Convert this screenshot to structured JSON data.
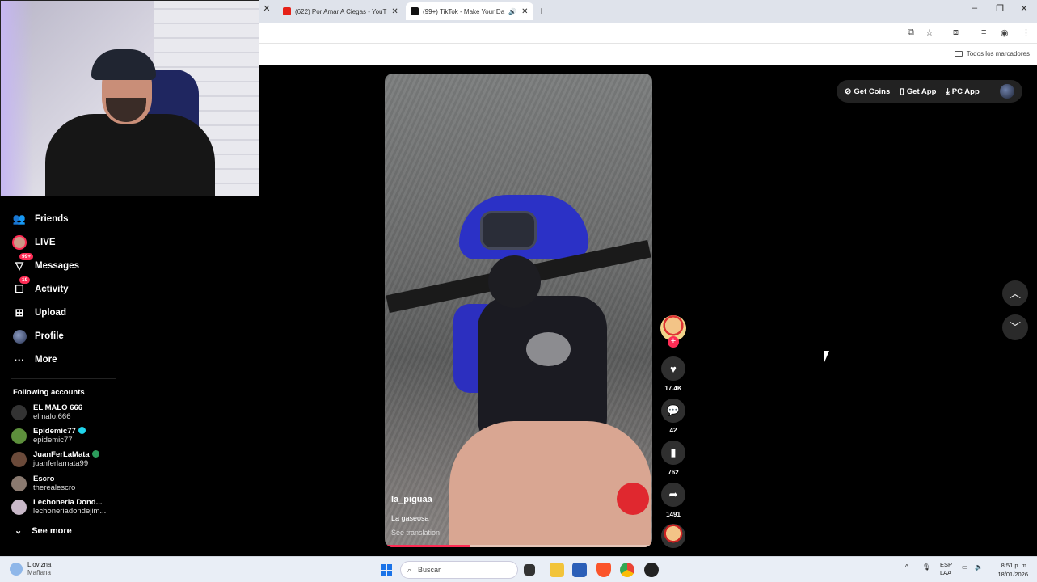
{
  "browser": {
    "tabs": [
      {
        "title": "(622) Por Amar A Ciegas - YouT",
        "active": false,
        "favicon_color": "#e62117"
      },
      {
        "title": "(99+) TikTok - Make Your Da",
        "active": true,
        "favicon_color": "#111111"
      }
    ],
    "new_tab_symbol": "+",
    "window_controls": [
      "–",
      "❐",
      "✕"
    ],
    "bookmarks_folder_label": "Todos los marcadores"
  },
  "sidebar": {
    "items": [
      {
        "label": "Friends",
        "icon": "friends-icon",
        "badge": ""
      },
      {
        "label": "LIVE",
        "icon": "live-icon",
        "badge": ""
      },
      {
        "label": "Messages",
        "icon": "messages-icon",
        "badge": "99+"
      },
      {
        "label": "Activity",
        "icon": "activity-icon",
        "badge": "19"
      },
      {
        "label": "Upload",
        "icon": "upload-icon",
        "badge": ""
      },
      {
        "label": "Profile",
        "icon": "profile-icon",
        "badge": ""
      },
      {
        "label": "More",
        "icon": "more-icon",
        "badge": ""
      }
    ],
    "following_title": "Following accounts",
    "accounts": [
      {
        "name": "EL MALO 666",
        "username": "elmalo.666",
        "verified": false,
        "color": "#333333"
      },
      {
        "name": "Epidemic77",
        "username": "epidemic77",
        "verified": true,
        "color": "#5d8f3c"
      },
      {
        "name": "JuanFerLaMata",
        "username": "juanferlamata99",
        "verified": true,
        "color": "#6b4a3a"
      },
      {
        "name": "Escro",
        "username": "therealescro",
        "verified": false,
        "color": "#8a7a70"
      },
      {
        "name": "Lechoneria Dond...",
        "username": "lechoneriadondejim...",
        "verified": false,
        "color": "#c9b8c9"
      }
    ],
    "see_more_label": "See more"
  },
  "video": {
    "username": "la_piguaa",
    "description": "La gaseosa",
    "translation_link": "See translation",
    "progress": 0.32
  },
  "actions": {
    "likes": "17.4K",
    "comments": "42",
    "saves": "762",
    "shares": "1491"
  },
  "top_buttons": {
    "get_coins": "Get Coins",
    "get_app": "Get App",
    "pc_app": "PC App"
  },
  "taskbar": {
    "weather_condition": "Llovizna",
    "weather_time": "Mañana",
    "search_placeholder": "Buscar",
    "language_line1": "ESP",
    "language_line2": "LAA",
    "time": "8:51 p. m.",
    "date": "18/01/2026"
  }
}
